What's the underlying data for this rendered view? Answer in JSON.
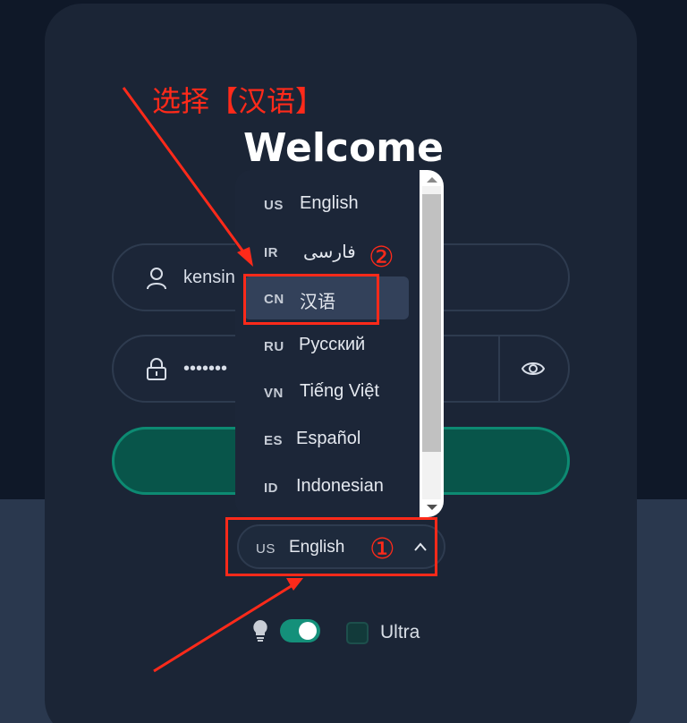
{
  "page": {
    "title": "Welcome"
  },
  "username": {
    "value": "kensin"
  },
  "password": {
    "masked_value": "•••••••"
  },
  "language_select": {
    "selected_code": "US",
    "selected_name": "English",
    "options": [
      {
        "code": "US",
        "name": "English"
      },
      {
        "code": "IR",
        "name": "فارسی"
      },
      {
        "code": "CN",
        "name": "汉语"
      },
      {
        "code": "RU",
        "name": "Русский"
      },
      {
        "code": "VN",
        "name": "Tiếng Việt"
      },
      {
        "code": "ES",
        "name": "Español"
      },
      {
        "code": "ID",
        "name": "Indonesian"
      }
    ],
    "highlighted_option": "CN"
  },
  "options_row": {
    "theme_toggle_on": true,
    "ultra_checked": false,
    "ultra_label": "Ultra"
  },
  "annotations": {
    "instruction": "选择【汉语】",
    "step1": "①",
    "step2": "②"
  },
  "colors": {
    "background": "#0f1828",
    "card": "#1b2536",
    "accent": "#14907a",
    "annotation": "#ff2a1a"
  }
}
